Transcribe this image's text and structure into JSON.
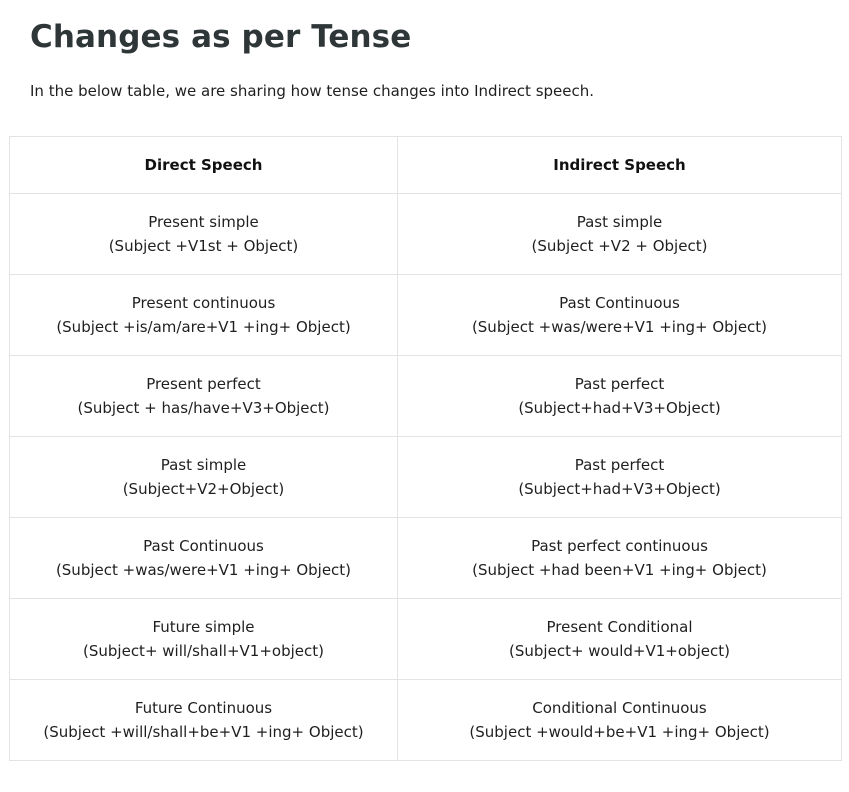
{
  "heading": "Changes as per Tense",
  "intro": "In the below table, we are sharing how tense changes into Indirect speech.",
  "table": {
    "headers": [
      "Direct Speech",
      "Indirect Speech"
    ],
    "rows": [
      [
        {
          "tense": "Present simple",
          "formula": "(Subject +V1st + Object)"
        },
        {
          "tense": "Past simple",
          "formula": "(Subject +V2 + Object)"
        }
      ],
      [
        {
          "tense": "Present continuous",
          "formula": "(Subject +is/am/are+V1 +ing+ Object)"
        },
        {
          "tense": "Past Continuous",
          "formula": "(Subject +was/were+V1 +ing+ Object)"
        }
      ],
      [
        {
          "tense": "Present perfect",
          "formula": "(Subject + has/have+V3+Object)"
        },
        {
          "tense": "Past perfect",
          "formula": "(Subject+had+V3+Object)"
        }
      ],
      [
        {
          "tense": "Past simple",
          "formula": "(Subject+V2+Object)"
        },
        {
          "tense": "Past perfect",
          "formula": "(Subject+had+V3+Object)"
        }
      ],
      [
        {
          "tense": "Past Continuous",
          "formula": "(Subject +was/were+V1 +ing+ Object)"
        },
        {
          "tense": "Past perfect continuous",
          "formula": "(Subject +had been+V1 +ing+ Object)"
        }
      ],
      [
        {
          "tense": "Future simple",
          "formula": "(Subject+ will/shall+V1+object)"
        },
        {
          "tense": "Present Conditional",
          "formula": "(Subject+ would+V1+object)"
        }
      ],
      [
        {
          "tense": "Future Continuous",
          "formula": "(Subject +will/shall+be+V1 +ing+ Object)"
        },
        {
          "tense": "Conditional Continuous",
          "formula": "(Subject +would+be+V1 +ing+ Object)"
        }
      ]
    ]
  }
}
